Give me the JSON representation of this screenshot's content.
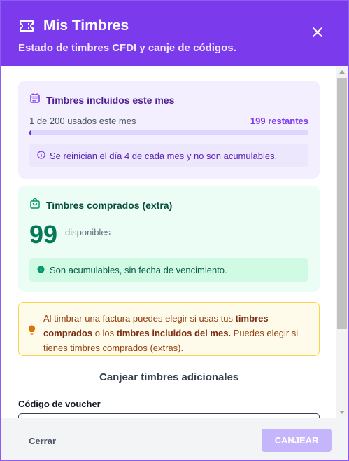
{
  "header": {
    "title": "Mis Timbres",
    "subtitle": "Estado de timbres CFDI y canje de códigos.",
    "icon": "ticket-icon",
    "close_icon": "close-icon"
  },
  "included": {
    "title": "Timbres incluidos este mes",
    "icon": "calendar-icon",
    "usage_text": "1 de 200 usados este mes",
    "remaining_text": "199 restantes",
    "used": 1,
    "total": 200,
    "progress_fraction": 0.005,
    "note": "Se reinician el día 4 de cada mes y no son acumulables.",
    "note_icon": "info-icon"
  },
  "purchased": {
    "title": "Timbres comprados (extra)",
    "icon": "shopping-bag-icon",
    "count": "99",
    "count_label": "disponibles",
    "note": "Son acumulables, sin fecha de vencimiento.",
    "note_icon": "info-icon"
  },
  "tip": {
    "icon": "lightbulb-icon",
    "part1": "Al timbrar una factura puedes elegir si usas tus ",
    "bold1": "timbres comprados",
    "part2": " o los ",
    "bold2": "timbres incluidos del mes.",
    "part3": " Puedes elegir si tienes timbres comprados (extras)."
  },
  "redeem_section": {
    "divider_label": "Canjear timbres adicionales",
    "field_label": "Código de voucher",
    "field_value": "",
    "field_placeholder": ""
  },
  "footer": {
    "cancel_label": "Cerrar",
    "submit_label": "CANJEAR"
  },
  "colors": {
    "header_bg": "#7c3aed",
    "purple_card_bg": "#f3effe",
    "green_card_bg": "#ecfdf5",
    "yellow_card_bg": "#fffbeb",
    "submit_disabled": "#c4b5fd"
  }
}
